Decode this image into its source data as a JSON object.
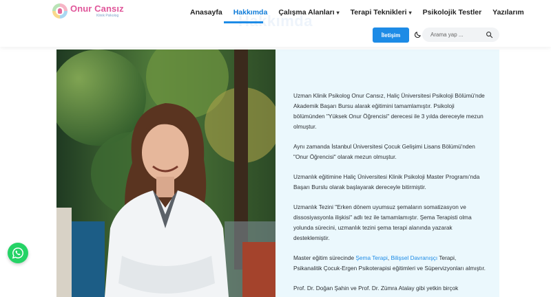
{
  "brand": {
    "name": "Onur Cansız",
    "subtitle": "Klinik Psikolog"
  },
  "nav": {
    "items": [
      {
        "label": "Anasayfa",
        "active": false,
        "dropdown": false
      },
      {
        "label": "Hakkımda",
        "active": true,
        "dropdown": false
      },
      {
        "label": "Çalışma Alanları",
        "active": false,
        "dropdown": true
      },
      {
        "label": "Terapi Teknikleri",
        "active": false,
        "dropdown": true
      },
      {
        "label": "Psikolojik Testler",
        "active": false,
        "dropdown": false
      },
      {
        "label": "Yazılarım",
        "active": false,
        "dropdown": false
      }
    ],
    "chevron": "▾"
  },
  "page": {
    "ghost_title": "Hakkımda"
  },
  "header_actions": {
    "contact_label": "İletişim",
    "theme_icon": "moon-icon",
    "search_placeholder": "Arama yap ...",
    "search_value": ""
  },
  "about": {
    "p1": "Uzman Klinik Psikolog Onur Cansız, Haliç Üniversitesi Psikoloji Bölümü'nde Akademik Başarı Bursu alarak eğitimini tamamlamıştır. Psikoloji bölümünden \"Yüksek Onur Öğrencisi\" derecesi ile 3 yılda dereceyle mezun olmuştur.",
    "p2": "Aynı zamanda İstanbul Üniversitesi Çocuk Gelişimi Lisans Bölümü'nden \"Onur Öğrencisi\" olarak mezun olmuştur.",
    "p3": "Uzmanlık eğitimine Haliç Üniversitesi Klinik Psikoloji Master Programı'nda Başarı Burslu olarak başlayarak dereceyle bitirmiştir.",
    "p4": "Uzmanlık Tezini \"Erken dönem uyumsuz şemaların somatizasyon ve dissosiyasyonla ilişkisi\" adlı tez ile tamamlamıştır. Şema Terapisti olma yolunda sürecini, uzmanlık tezini şema terapi alanında yazarak desteklemiştir.",
    "p5_before": "Master eğitim sürecinde ",
    "p5_link1": "Şema Terapi",
    "p5_sep": ", ",
    "p5_link2": "Bilişsel Davranışçı",
    "p5_after": " Terapi, Psikanalitik Çocuk-Ergen Psikoterapisi eğitimleri ve Süpervizyonları almıştır.",
    "p6": "Prof. Dr. Doğan Şahin ve Prof. Dr. Zümra Atalay gibi yetkin birçok"
  },
  "colors": {
    "accent": "#1d8be6",
    "brand_pink": "#e0569a",
    "panel": "#ebf8fd",
    "whatsapp": "#25d366"
  },
  "floating": {
    "whatsapp_icon": "whatsapp-icon"
  }
}
